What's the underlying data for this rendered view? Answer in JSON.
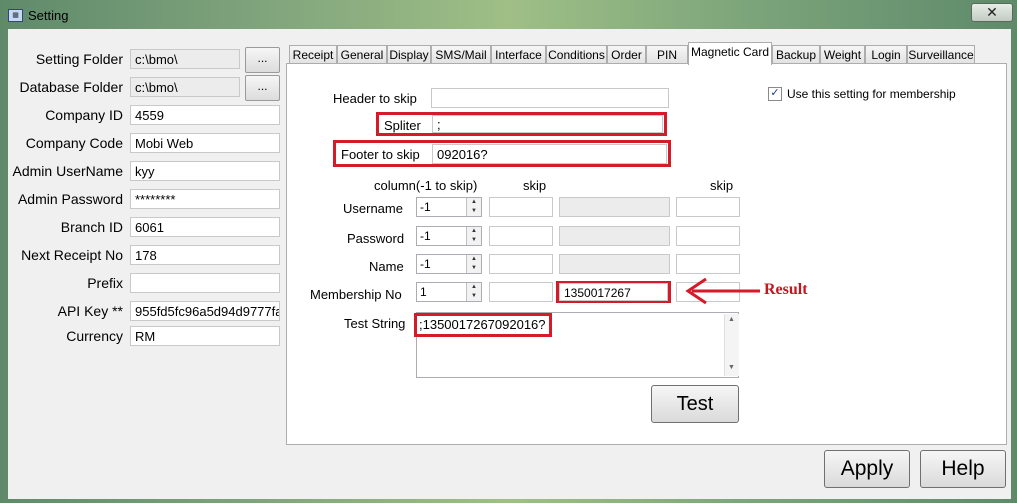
{
  "window": {
    "title": "Setting",
    "close_glyph": "✕"
  },
  "left_fields": [
    {
      "label": "Setting Folder",
      "value": "c:\\bmo\\"
    },
    {
      "label": "Database Folder",
      "value": "c:\\bmo\\"
    },
    {
      "label": "Company ID",
      "value": "4559"
    },
    {
      "label": "Company Code",
      "value": "Mobi Web"
    },
    {
      "label": "Admin UserName",
      "value": "kyy"
    },
    {
      "label": "Admin Password",
      "value": "********"
    },
    {
      "label": "Branch ID",
      "value": "6061"
    },
    {
      "label": "Next Receipt No",
      "value": "178"
    },
    {
      "label": "Prefix",
      "value": ""
    },
    {
      "label": "API Key **",
      "value": "955fd5fc96a5d94d9777fa"
    },
    {
      "label": "Currency",
      "value": "RM"
    }
  ],
  "browse_label": "...",
  "tabs": [
    "Receipt",
    "General",
    "Display",
    "SMS/Mail",
    "Interface",
    "Conditions",
    "Order",
    "PIN",
    "Magnetic Card",
    "Backup",
    "Weight",
    "Login",
    "Surveillance"
  ],
  "active_tab": "Magnetic Card",
  "magnetic": {
    "header_label": "Header to skip",
    "header_value": "",
    "spliter_label": "Spliter",
    "spliter_value": ";",
    "footer_label": "Footer to skip",
    "footer_value": "092016?",
    "use_setting_label": "Use this setting for membership",
    "use_setting_checked": true,
    "col_header": "column(-1 to skip)",
    "skip_header_1": "skip",
    "skip_header_2": "skip",
    "rows": [
      {
        "label": "Username",
        "column": "-1",
        "skip": "",
        "result": "",
        "skip2": ""
      },
      {
        "label": "Password",
        "column": "-1",
        "skip": "",
        "result": "",
        "skip2": ""
      },
      {
        "label": "Name",
        "column": "-1",
        "skip": "",
        "result": "",
        "skip2": ""
      },
      {
        "label": "Membership No",
        "column": "1",
        "skip": "",
        "result": "1350017267",
        "skip2": ""
      }
    ],
    "test_string_label": "Test String",
    "test_string_value": ";1350017267092016?",
    "test_button": "Test"
  },
  "annotation": {
    "result_label": "Result",
    "color": "#d51a2a"
  },
  "footer": {
    "apply": "Apply",
    "help": "Help"
  }
}
